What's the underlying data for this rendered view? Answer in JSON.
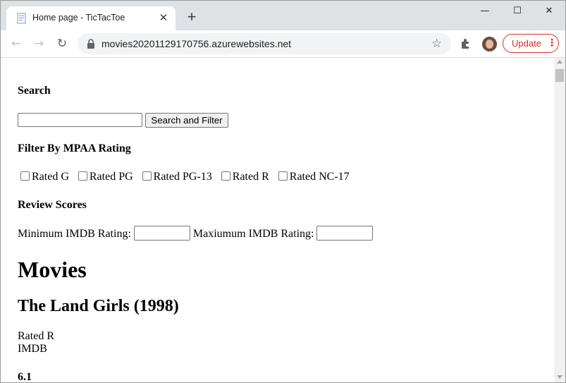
{
  "browser": {
    "tab_title": "Home page - TicTacToe",
    "tab_close": "✕",
    "new_tab": "+",
    "url": "movies20201129170756.azurewebsites.net",
    "update_label": "Update",
    "update_menu": "⋮",
    "window_controls": {
      "minimize": "—",
      "maximize": "☐",
      "close": "✕"
    },
    "icons": [
      "back-icon",
      "forward-icon",
      "reload-icon",
      "lock-icon",
      "star-icon",
      "extensions-icon",
      "avatar"
    ]
  },
  "page": {
    "search_heading": "Search",
    "search_input_value": "",
    "search_button": "Search and Filter",
    "filter_heading": "Filter By MPAA Rating",
    "rating_options": [
      {
        "label": "Rated G",
        "checked": false
      },
      {
        "label": "Rated PG",
        "checked": false
      },
      {
        "label": "Rated PG-13",
        "checked": false
      },
      {
        "label": "Rated R",
        "checked": false
      },
      {
        "label": "Rated NC-17",
        "checked": false
      }
    ],
    "review_heading": "Review Scores",
    "min_label": "Minimum IMDB Rating:",
    "min_value": "",
    "max_label": "Maxiumum IMDB Rating:",
    "max_value": "",
    "movies_heading": "Movies",
    "movie": {
      "title": "The Land Girls (1998)",
      "rated": "Rated R",
      "imdb_label": "IMDB",
      "imdb_score": "6.1"
    }
  }
}
